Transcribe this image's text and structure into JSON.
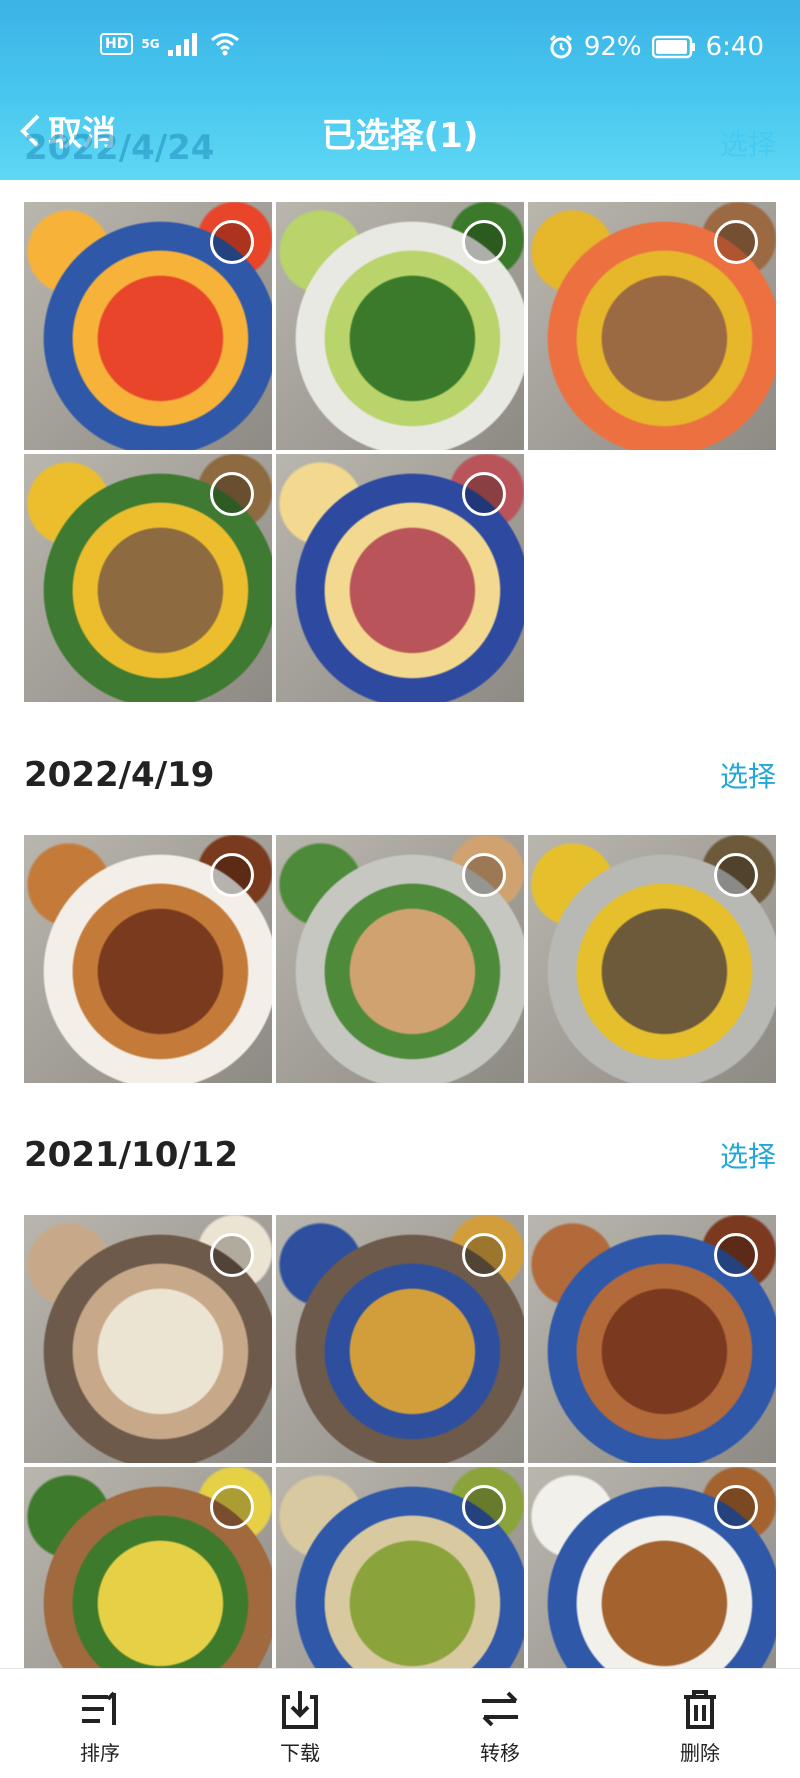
{
  "status": {
    "network": "5G",
    "hd": "HD",
    "battery": "92%",
    "time": "6:40"
  },
  "header": {
    "back_label": "取消",
    "title": "已选择(1)"
  },
  "overlay": {
    "date": "2022/4/24",
    "select": "选择"
  },
  "groups": [
    {
      "date": "2022/4/24",
      "select": "选择",
      "photos": [
        {
          "name": "tomato-eggs",
          "colors": [
            "#e8452a",
            "#f7b23a",
            "#2f58a8"
          ]
        },
        {
          "name": "pepper-greens",
          "colors": [
            "#3a7a2a",
            "#b8d46a",
            "#e9e9e4"
          ]
        },
        {
          "name": "corn-soup",
          "colors": [
            "#9b6a43",
            "#e6b72a",
            "#ed7040"
          ]
        },
        {
          "name": "mixed-soups",
          "colors": [
            "#8d6a3f",
            "#ecbe2e",
            "#3e7a31"
          ]
        },
        {
          "name": "sausage-noodles",
          "colors": [
            "#b9555a",
            "#f2d98f",
            "#2e4aa0"
          ]
        }
      ]
    },
    {
      "date": "2022/4/19",
      "select": "选择",
      "photos": [
        {
          "name": "braised-fish",
          "colors": [
            "#7a3a1d",
            "#c47b3a",
            "#f3efe8"
          ]
        },
        {
          "name": "tofu-greens",
          "colors": [
            "#d0a270",
            "#4d8a3a",
            "#c7c7c2"
          ]
        },
        {
          "name": "pickled-soup",
          "colors": [
            "#6d5a3a",
            "#e6c02c",
            "#b8b8b4"
          ]
        }
      ]
    },
    {
      "date": "2021/10/12",
      "select": "选择",
      "photos": [
        {
          "name": "dumplings",
          "colors": [
            "#ece4d2",
            "#c7a98a",
            "#6d5a4a"
          ]
        },
        {
          "name": "sesame-cakes",
          "colors": [
            "#d29e3c",
            "#2d4f9e",
            "#6e5a4a"
          ]
        },
        {
          "name": "fried-chicken",
          "colors": [
            "#7b3a20",
            "#b26a3a",
            "#2f58a8"
          ]
        },
        {
          "name": "eggs-peppers",
          "colors": [
            "#e5d046",
            "#3d7a2c",
            "#a0693e"
          ]
        },
        {
          "name": "shredded-stirfry",
          "colors": [
            "#8aa43b",
            "#d9c9a0",
            "#2f58a8"
          ]
        },
        {
          "name": "braised-duck",
          "colors": [
            "#a3622e",
            "#f1f0ea",
            "#2f58a8"
          ]
        }
      ]
    }
  ],
  "bottom_bar": [
    {
      "label": "排序",
      "icon": "sort-icon"
    },
    {
      "label": "下载",
      "icon": "download-icon"
    },
    {
      "label": "转移",
      "icon": "transfer-icon"
    },
    {
      "label": "删除",
      "icon": "delete-icon"
    }
  ]
}
